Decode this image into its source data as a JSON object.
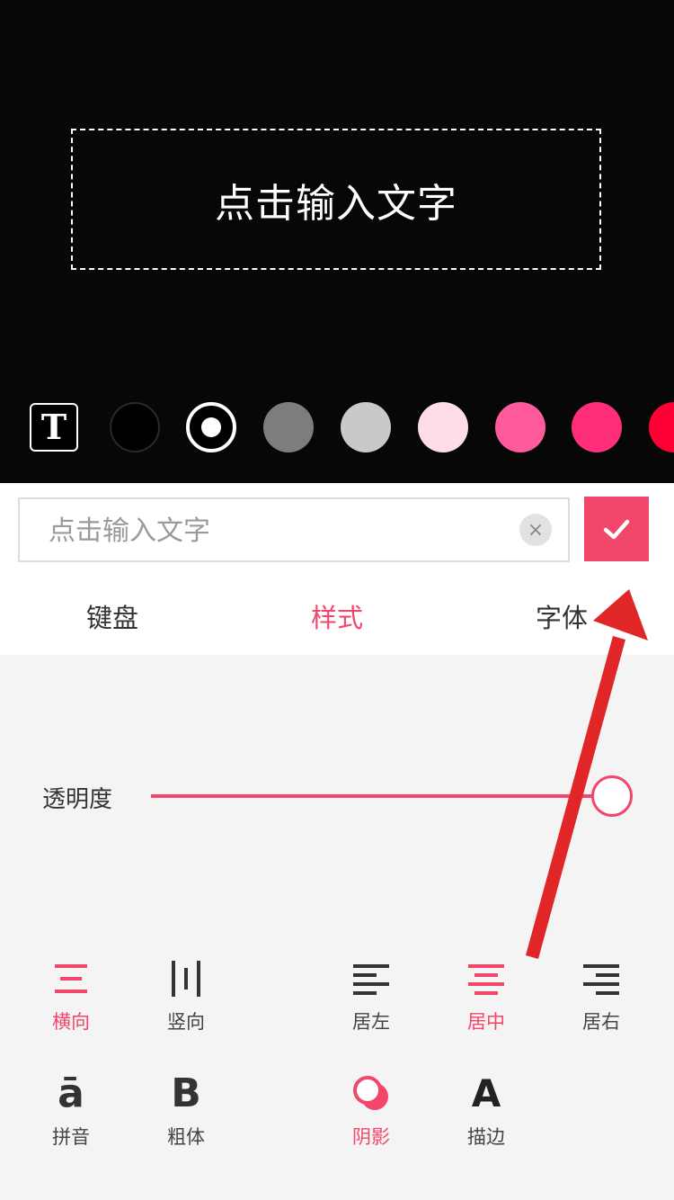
{
  "preview": {
    "placeholder_text": "点击输入文字",
    "text_style_icon": "T"
  },
  "palette": {
    "colors": [
      "#000000",
      "#ffffff",
      "#7d7d7d",
      "#c9c9c9",
      "#ffdde8",
      "#ff5a9a",
      "#ff2d7a",
      "#ff0036"
    ],
    "selected": 1
  },
  "editor": {
    "input_placeholder": "点击输入文字",
    "input_value": "",
    "clear_icon": "×",
    "accent": "#f2466a"
  },
  "tabs": [
    {
      "label": "键盘"
    },
    {
      "label": "样式"
    },
    {
      "label": "字体"
    }
  ],
  "active_tab": 1,
  "style_panel": {
    "opacity_label": "透明度",
    "opacity_value": 1.0,
    "options_row1": [
      {
        "label": "横向",
        "icon": "horizontal-lines-icon",
        "active": true
      },
      {
        "label": "竖向",
        "icon": "vertical-lines-icon",
        "active": false
      },
      {
        "label": "居左",
        "icon": "align-left-icon",
        "active": false
      },
      {
        "label": "居中",
        "icon": "align-center-icon",
        "active": true
      },
      {
        "label": "居右",
        "icon": "align-right-icon",
        "active": false
      }
    ],
    "options_row2": [
      {
        "label": "拼音",
        "icon": "pinyin-icon",
        "glyph": "ā",
        "active": false
      },
      {
        "label": "粗体",
        "icon": "bold-icon",
        "glyph": "B",
        "active": false
      },
      {
        "label": "阴影",
        "icon": "shadow-icon",
        "active": true
      },
      {
        "label": "描边",
        "icon": "outline-icon",
        "glyph": "A",
        "active": false
      }
    ]
  }
}
